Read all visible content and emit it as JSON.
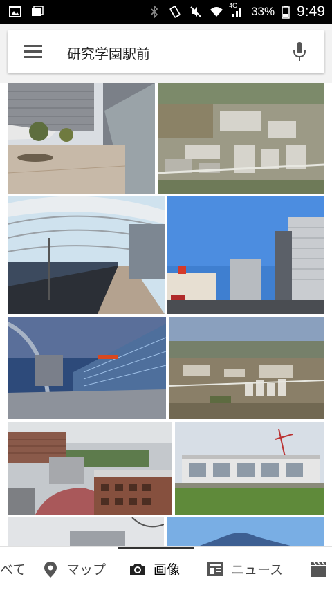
{
  "status_bar": {
    "network": "4G",
    "battery": "33%",
    "time": "9:49",
    "icons": [
      "photo-icon",
      "screenshot-icon",
      "bluetooth-icon",
      "vibrate-icon",
      "mute-icon",
      "wifi-icon",
      "signal-icon",
      "battery-icon"
    ]
  },
  "search": {
    "query": "研究学園駅前",
    "menu_icon": "hamburger-menu-icon",
    "mic_icon": "microphone-icon"
  },
  "results": {
    "images": [
      {
        "name": "result-image-1",
        "alt": "station plaza"
      },
      {
        "name": "result-image-2",
        "alt": "aerial city"
      },
      {
        "name": "result-image-3",
        "alt": "station platform"
      },
      {
        "name": "result-image-4",
        "alt": "tower buildings"
      },
      {
        "name": "result-image-5",
        "alt": "station building fisheye"
      },
      {
        "name": "result-image-6",
        "alt": "aerial plain"
      },
      {
        "name": "result-image-7",
        "alt": "city buildings"
      },
      {
        "name": "result-image-8",
        "alt": "elevated station"
      },
      {
        "name": "result-image-9",
        "alt": "partial sky"
      },
      {
        "name": "result-image-10",
        "alt": "partial mountain"
      }
    ]
  },
  "tabs": [
    {
      "label": "べて",
      "icon": ""
    },
    {
      "label": "マップ",
      "icon": "map-pin-icon"
    },
    {
      "label": "画像",
      "icon": "camera-icon",
      "active": true
    },
    {
      "label": "ニュース",
      "icon": "news-icon"
    },
    {
      "label": "",
      "icon": "video-icon"
    }
  ]
}
